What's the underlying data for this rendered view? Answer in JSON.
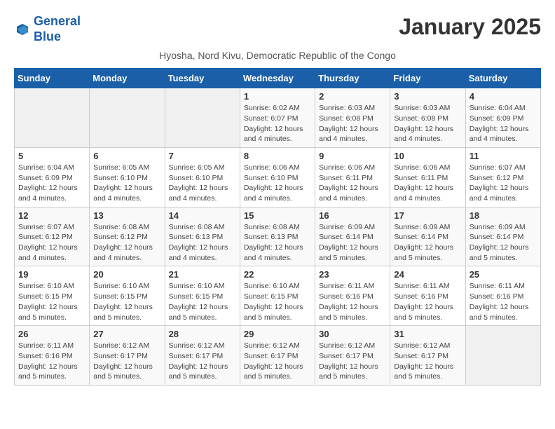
{
  "logo": {
    "line1": "General",
    "line2": "Blue"
  },
  "title": "January 2025",
  "subtitle": "Hyosha, Nord Kivu, Democratic Republic of the Congo",
  "headers": [
    "Sunday",
    "Monday",
    "Tuesday",
    "Wednesday",
    "Thursday",
    "Friday",
    "Saturday"
  ],
  "weeks": [
    [
      {
        "day": "",
        "info": ""
      },
      {
        "day": "",
        "info": ""
      },
      {
        "day": "",
        "info": ""
      },
      {
        "day": "1",
        "info": "Sunrise: 6:02 AM\nSunset: 6:07 PM\nDaylight: 12 hours\nand 4 minutes."
      },
      {
        "day": "2",
        "info": "Sunrise: 6:03 AM\nSunset: 6:08 PM\nDaylight: 12 hours\nand 4 minutes."
      },
      {
        "day": "3",
        "info": "Sunrise: 6:03 AM\nSunset: 6:08 PM\nDaylight: 12 hours\nand 4 minutes."
      },
      {
        "day": "4",
        "info": "Sunrise: 6:04 AM\nSunset: 6:09 PM\nDaylight: 12 hours\nand 4 minutes."
      }
    ],
    [
      {
        "day": "5",
        "info": "Sunrise: 6:04 AM\nSunset: 6:09 PM\nDaylight: 12 hours\nand 4 minutes."
      },
      {
        "day": "6",
        "info": "Sunrise: 6:05 AM\nSunset: 6:10 PM\nDaylight: 12 hours\nand 4 minutes."
      },
      {
        "day": "7",
        "info": "Sunrise: 6:05 AM\nSunset: 6:10 PM\nDaylight: 12 hours\nand 4 minutes."
      },
      {
        "day": "8",
        "info": "Sunrise: 6:06 AM\nSunset: 6:10 PM\nDaylight: 12 hours\nand 4 minutes."
      },
      {
        "day": "9",
        "info": "Sunrise: 6:06 AM\nSunset: 6:11 PM\nDaylight: 12 hours\nand 4 minutes."
      },
      {
        "day": "10",
        "info": "Sunrise: 6:06 AM\nSunset: 6:11 PM\nDaylight: 12 hours\nand 4 minutes."
      },
      {
        "day": "11",
        "info": "Sunrise: 6:07 AM\nSunset: 6:12 PM\nDaylight: 12 hours\nand 4 minutes."
      }
    ],
    [
      {
        "day": "12",
        "info": "Sunrise: 6:07 AM\nSunset: 6:12 PM\nDaylight: 12 hours\nand 4 minutes."
      },
      {
        "day": "13",
        "info": "Sunrise: 6:08 AM\nSunset: 6:12 PM\nDaylight: 12 hours\nand 4 minutes."
      },
      {
        "day": "14",
        "info": "Sunrise: 6:08 AM\nSunset: 6:13 PM\nDaylight: 12 hours\nand 4 minutes."
      },
      {
        "day": "15",
        "info": "Sunrise: 6:08 AM\nSunset: 6:13 PM\nDaylight: 12 hours\nand 4 minutes."
      },
      {
        "day": "16",
        "info": "Sunrise: 6:09 AM\nSunset: 6:14 PM\nDaylight: 12 hours\nand 5 minutes."
      },
      {
        "day": "17",
        "info": "Sunrise: 6:09 AM\nSunset: 6:14 PM\nDaylight: 12 hours\nand 5 minutes."
      },
      {
        "day": "18",
        "info": "Sunrise: 6:09 AM\nSunset: 6:14 PM\nDaylight: 12 hours\nand 5 minutes."
      }
    ],
    [
      {
        "day": "19",
        "info": "Sunrise: 6:10 AM\nSunset: 6:15 PM\nDaylight: 12 hours\nand 5 minutes."
      },
      {
        "day": "20",
        "info": "Sunrise: 6:10 AM\nSunset: 6:15 PM\nDaylight: 12 hours\nand 5 minutes."
      },
      {
        "day": "21",
        "info": "Sunrise: 6:10 AM\nSunset: 6:15 PM\nDaylight: 12 hours\nand 5 minutes."
      },
      {
        "day": "22",
        "info": "Sunrise: 6:10 AM\nSunset: 6:15 PM\nDaylight: 12 hours\nand 5 minutes."
      },
      {
        "day": "23",
        "info": "Sunrise: 6:11 AM\nSunset: 6:16 PM\nDaylight: 12 hours\nand 5 minutes."
      },
      {
        "day": "24",
        "info": "Sunrise: 6:11 AM\nSunset: 6:16 PM\nDaylight: 12 hours\nand 5 minutes."
      },
      {
        "day": "25",
        "info": "Sunrise: 6:11 AM\nSunset: 6:16 PM\nDaylight: 12 hours\nand 5 minutes."
      }
    ],
    [
      {
        "day": "26",
        "info": "Sunrise: 6:11 AM\nSunset: 6:16 PM\nDaylight: 12 hours\nand 5 minutes."
      },
      {
        "day": "27",
        "info": "Sunrise: 6:12 AM\nSunset: 6:17 PM\nDaylight: 12 hours\nand 5 minutes."
      },
      {
        "day": "28",
        "info": "Sunrise: 6:12 AM\nSunset: 6:17 PM\nDaylight: 12 hours\nand 5 minutes."
      },
      {
        "day": "29",
        "info": "Sunrise: 6:12 AM\nSunset: 6:17 PM\nDaylight: 12 hours\nand 5 minutes."
      },
      {
        "day": "30",
        "info": "Sunrise: 6:12 AM\nSunset: 6:17 PM\nDaylight: 12 hours\nand 5 minutes."
      },
      {
        "day": "31",
        "info": "Sunrise: 6:12 AM\nSunset: 6:17 PM\nDaylight: 12 hours\nand 5 minutes."
      },
      {
        "day": "",
        "info": ""
      }
    ]
  ]
}
